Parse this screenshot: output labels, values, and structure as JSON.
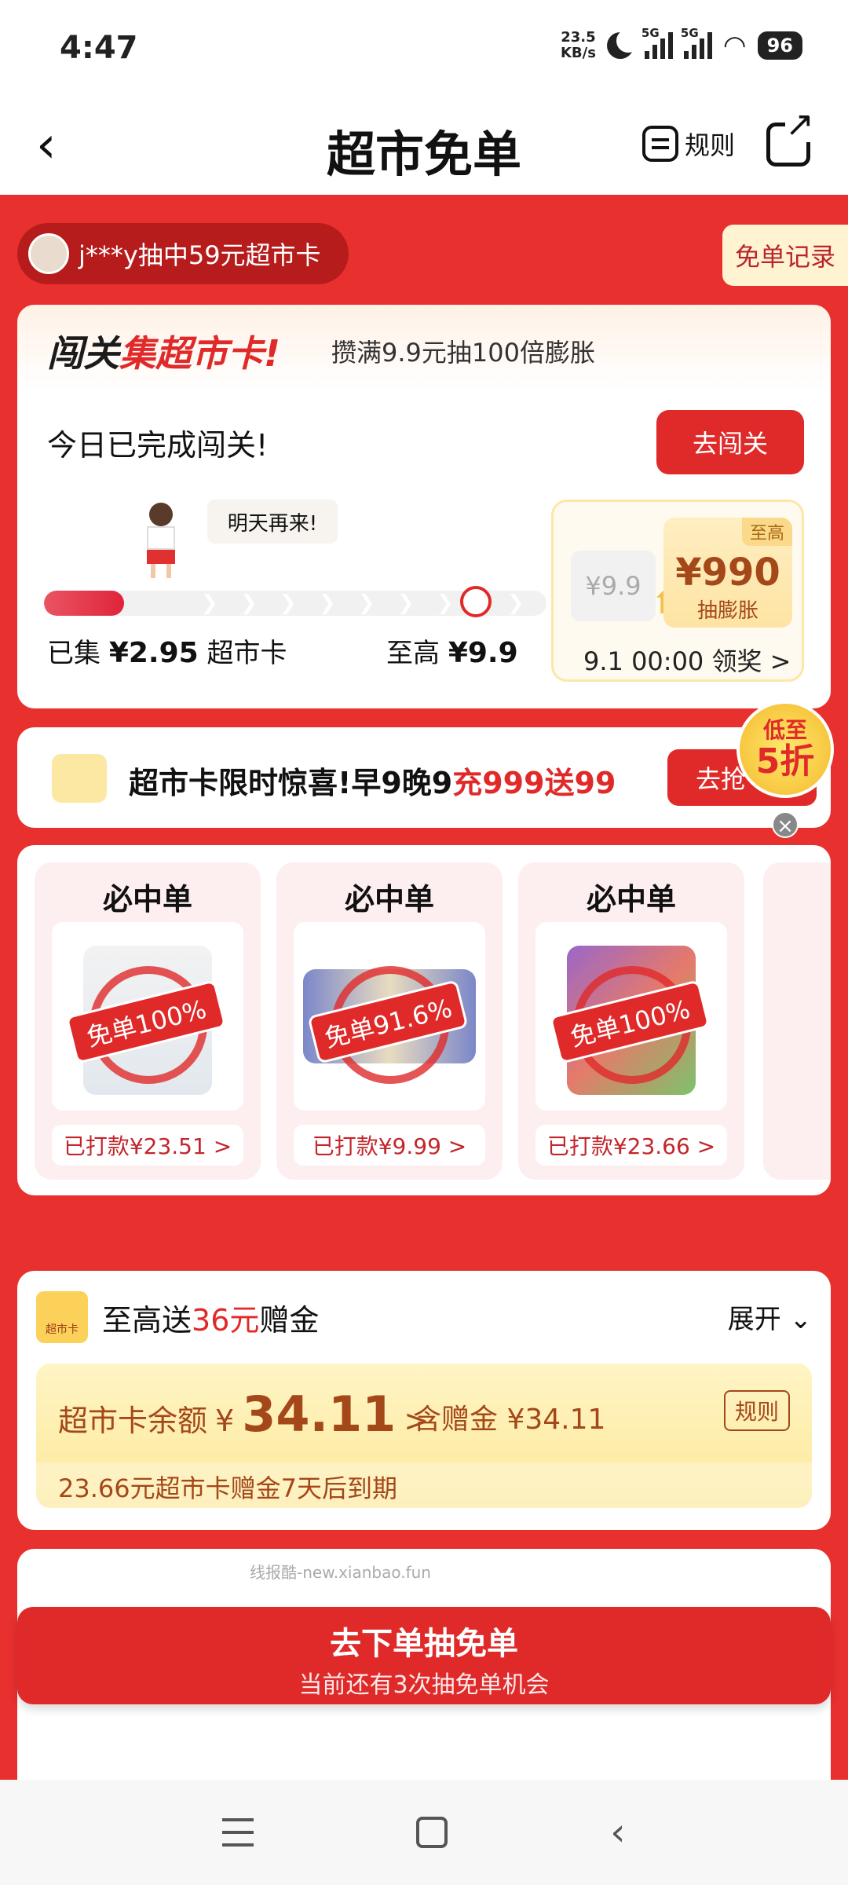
{
  "status_bar": {
    "time": "4:47",
    "speed_value": "23.5",
    "speed_unit": "KB/s",
    "net1": "5G",
    "net2": "5G",
    "battery": "96"
  },
  "nav": {
    "title": "超市免单",
    "rules_label": "规则"
  },
  "winner": {
    "text": "j***y抽中59元超市卡"
  },
  "record_button": "免单记录",
  "challenge": {
    "head_black": "闯关",
    "head_red": "集超市卡!",
    "subtitle": "攒满9.9元抽100倍膨胀",
    "done_text": "今日已完成闯关!",
    "go_button": "去闯关",
    "bubble": "明天再来!",
    "progress": 0.16,
    "collected_prefix": "已集",
    "collected_amount": "¥2.95",
    "collected_suffix": "超市卡",
    "max_prefix": "至高",
    "max_amount": "¥9.9",
    "prize_original": "¥9.9",
    "prize_tag": "至高",
    "prize_amount": "¥990",
    "prize_label": "抽膨胀",
    "claim_text": "9.1 00:00 领奖 >"
  },
  "promo": {
    "text_black": "超市卡限时惊喜!早9晚9",
    "text_red": "充999送99",
    "button": "去抢",
    "badge_top": "低至",
    "badge_big": "5折"
  },
  "products": [
    {
      "title": "必中单",
      "stamp": "免单100%",
      "paid": "已打款¥23.51 >"
    },
    {
      "title": "必中单",
      "stamp": "免单91.6%",
      "paid": "已打款¥9.99 >"
    },
    {
      "title": "必中单",
      "stamp": "免单100%",
      "paid": "已打款¥23.66 >"
    }
  ],
  "supermarket_card": {
    "logo_text": "超市卡",
    "gift_prefix": "至高送",
    "gift_amount": "36元",
    "gift_suffix": "赠金",
    "expand": "展开 ⌄",
    "balance_label": "超市卡余额",
    "balance_currency": "¥",
    "balance_amount": "34.11",
    "balance_arrow": ">",
    "includes": "含赠金 ¥34.11",
    "rules_button": "规则",
    "expiry": "23.66元超市卡赠金7天后到期"
  },
  "watermark": "线报酷-new.xianbao.fun",
  "cta": {
    "main": "去下单抽免单",
    "sub": "当前还有3次抽免单机会"
  }
}
